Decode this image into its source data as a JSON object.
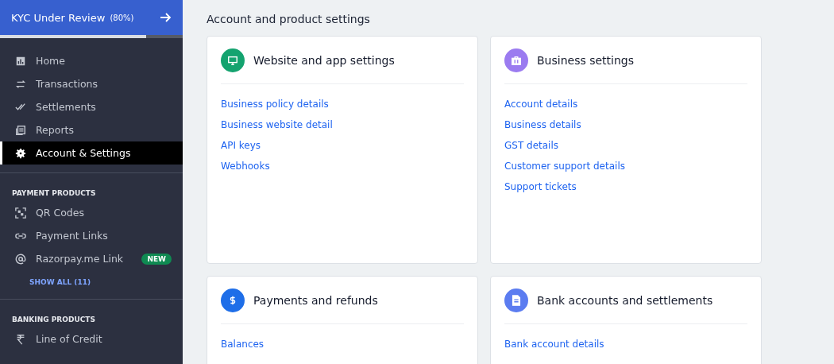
{
  "kyc_banner": {
    "title": "KYC Under Review",
    "percent": "(80%)",
    "level": 0.8
  },
  "sidebar": {
    "items": [
      {
        "label": "Home",
        "selected": false
      },
      {
        "label": "Transactions",
        "selected": false
      },
      {
        "label": "Settlements",
        "selected": false
      },
      {
        "label": "Reports",
        "selected": false
      },
      {
        "label": "Account & Settings",
        "selected": true
      }
    ],
    "sections": [
      {
        "title": "PAYMENT PRODUCTS",
        "items": [
          {
            "label": "QR Codes"
          },
          {
            "label": "Payment Links"
          },
          {
            "label": "Razorpay.me Link",
            "badge": "NEW"
          }
        ],
        "show_all": "SHOW ALL (11)"
      },
      {
        "title": "BANKING PRODUCTS",
        "items": [
          {
            "label": "Line of Credit"
          }
        ]
      }
    ]
  },
  "page_title": "Account and product settings",
  "cards": [
    {
      "title": "Website and app settings",
      "color": "#14a36f",
      "links": [
        "Business policy details",
        "Business website detail",
        "API keys",
        "Webhooks"
      ]
    },
    {
      "title": "Business settings",
      "color": "#9b7bf0",
      "links": [
        "Account details",
        "Business details",
        "GST details",
        "Customer support details",
        "Support tickets"
      ]
    },
    {
      "title": "Payments and refunds",
      "color": "#1e6ee8",
      "links": [
        "Balances"
      ]
    },
    {
      "title": "Bank accounts and settlements",
      "color": "#5b7cf0",
      "links": [
        "Bank account details"
      ]
    }
  ]
}
